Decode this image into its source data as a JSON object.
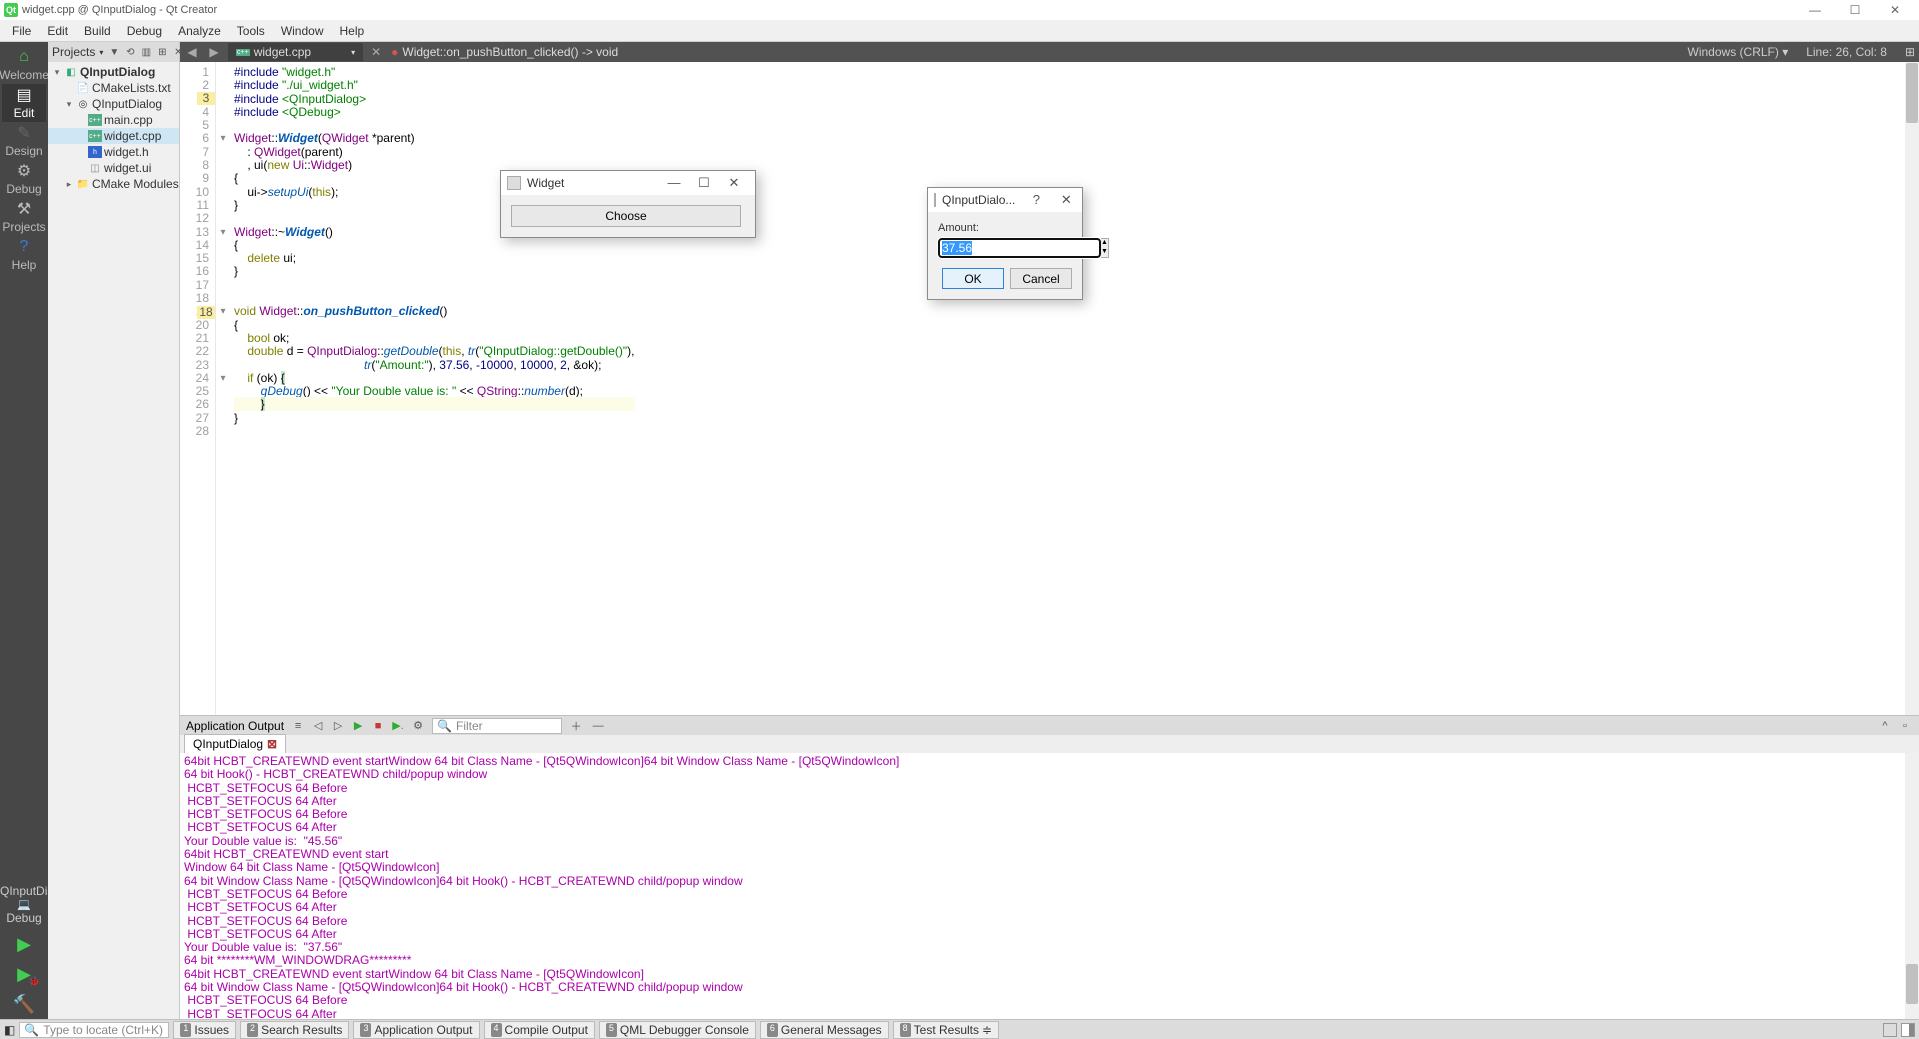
{
  "window": {
    "title": "widget.cpp @ QInputDialog - Qt Creator"
  },
  "menus": [
    "File",
    "Edit",
    "Build",
    "Debug",
    "Analyze",
    "Tools",
    "Window",
    "Help"
  ],
  "sidebar": {
    "modes": [
      {
        "label": "Welcome"
      },
      {
        "label": "Edit"
      },
      {
        "label": "Design"
      },
      {
        "label": "Debug"
      },
      {
        "label": "Projects"
      },
      {
        "label": "Help"
      }
    ],
    "kit": "QInputDialog",
    "kitMode": "Debug"
  },
  "projectPane": {
    "title": "Projects",
    "nodes": {
      "root": "QInputDialog",
      "cmake": "CMakeLists.txt",
      "sub": "QInputDialog",
      "main": "main.cpp",
      "widgetcpp": "widget.cpp",
      "widgeth": "widget.h",
      "widgetui": "widget.ui",
      "cmakeMods": "CMake Modules"
    }
  },
  "editor": {
    "doc": "widget.cpp",
    "symbol": "Widget::on_pushButton_clicked() -> void",
    "encoding": "Windows (CRLF)",
    "pos": "Line: 26, Col: 8",
    "lines": 28
  },
  "outputHeader": {
    "title": "Application Output",
    "filterPlaceholder": "Filter",
    "tab": "QInputDialog"
  },
  "outputLines": [
    "64bit HCBT_CREATEWND event startWindow 64 bit Class Name - [Qt5QWindowIcon]64 bit Window Class Name - [Qt5QWindowIcon]",
    "64 bit Hook() - HCBT_CREATEWND child/popup window",
    " HCBT_SETFOCUS 64 Before",
    " HCBT_SETFOCUS 64 After",
    " HCBT_SETFOCUS 64 Before",
    " HCBT_SETFOCUS 64 After",
    "Your Double value is:  \"45.56\"",
    "64bit HCBT_CREATEWND event start",
    "Window 64 bit Class Name - [Qt5QWindowIcon]",
    "64 bit Window Class Name - [Qt5QWindowIcon]64 bit Hook() - HCBT_CREATEWND child/popup window",
    " HCBT_SETFOCUS 64 Before",
    " HCBT_SETFOCUS 64 After",
    " HCBT_SETFOCUS 64 Before",
    " HCBT_SETFOCUS 64 After",
    "Your Double value is:  \"37.56\"",
    "64 bit ********WM_WINDOWDRAG*********",
    "64bit HCBT_CREATEWND event startWindow 64 bit Class Name - [Qt5QWindowIcon]",
    "64 bit Window Class Name - [Qt5QWindowIcon]64 bit Hook() - HCBT_CREATEWND child/popup window",
    " HCBT_SETFOCUS 64 Before",
    " HCBT_SETFOCUS 64 After"
  ],
  "status": {
    "locatorPlaceholder": "Type to locate (Ctrl+K)",
    "tabs": [
      {
        "n": "1",
        "label": "Issues"
      },
      {
        "n": "2",
        "label": "Search Results"
      },
      {
        "n": "3",
        "label": "Application Output"
      },
      {
        "n": "4",
        "label": "Compile Output"
      },
      {
        "n": "5",
        "label": "QML Debugger Console"
      },
      {
        "n": "6",
        "label": "General Messages"
      },
      {
        "n": "8",
        "label": "Test Results"
      }
    ]
  },
  "widgetDialog": {
    "title": "Widget",
    "button": "Choose"
  },
  "inputDialog": {
    "title": "QInputDialo...",
    "label": "Amount:",
    "value": "37.56",
    "ok": "OK",
    "cancel": "Cancel"
  }
}
